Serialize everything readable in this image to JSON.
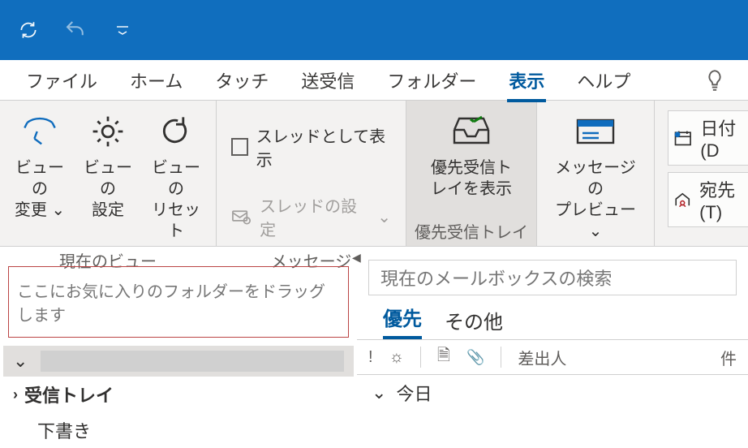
{
  "ribbonTabs": {
    "file": "ファイル",
    "home": "ホーム",
    "touch": "タッチ",
    "sendreceive": "送受信",
    "folder": "フォルダー",
    "view": "表示",
    "help": "ヘルプ"
  },
  "groups": {
    "currentView": {
      "changeView": "ビューの\n変更",
      "viewSettings": "ビューの\n設定",
      "resetView": "ビューの\nリセット",
      "label": "現在のビュー"
    },
    "messages": {
      "showAsThread": "スレッドとして表示",
      "threadSettings": "スレッドの設定",
      "label": "メッセージ"
    },
    "focused": {
      "showFocused": "優先受信ト\nレイを表示",
      "label": "優先受信トレイ"
    },
    "preview": {
      "msgPreview": "メッセージの\nプレビュー"
    },
    "arrange": {
      "date": "日付(D",
      "to": "宛先(T)"
    }
  },
  "nav": {
    "favPlaceholder": "ここにお気に入りのフォルダーをドラッグします",
    "inbox": "受信トレイ",
    "drafts": "下書き"
  },
  "content": {
    "searchPlaceholder": "現在のメールボックスの検索",
    "focusedTab": "優先",
    "otherTab": "その他",
    "fromCol": "差出人",
    "subjCol": "件",
    "todayGroup": "今日"
  }
}
